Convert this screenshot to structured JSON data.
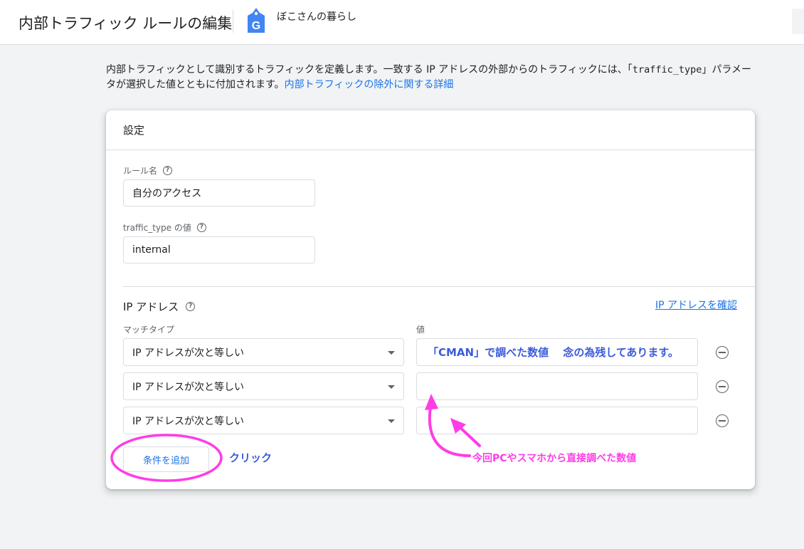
{
  "header": {
    "title": "内部トラフィック ルールの編集",
    "property_name": "ぼこさんの暮らし",
    "tag_letter": "G"
  },
  "description": {
    "text_part1": "内部トラフィックとして識別するトラフィックを定義します。一致する IP アドレスの外部からのトラフィックには、「",
    "code": "traffic_type",
    "text_part2": "」パラメータが選択した値とともに付加されます。",
    "link_text": "内部トラフィックの除外に関する詳細"
  },
  "settings": {
    "title": "設定",
    "rule_name_label": "ルール名",
    "rule_name_value": "自分のアクセス",
    "traffic_type_label": "traffic_type の値",
    "traffic_type_value": "internal"
  },
  "ip_section": {
    "title": "IP アドレス",
    "verify_link": "IP アドレスを確認",
    "match_type_label": "マッチタイプ",
    "value_label": "値",
    "conditions": [
      {
        "match_type": "IP アドレスが次と等しい",
        "value": ""
      },
      {
        "match_type": "IP アドレスが次と等しい",
        "value": ""
      },
      {
        "match_type": "IP アドレスが次と等しい",
        "value": ""
      }
    ],
    "add_condition_label": "条件を追加"
  },
  "annotations": {
    "click_label": "クリック",
    "cman_note": "「CMAN」で調べた数値　 念の為残してあります。",
    "device_note": "今回PCやスマホから直接調べた数値",
    "colors": {
      "pink": "#ff3ce6",
      "blue": "#3b5bdb"
    }
  },
  "icons": {
    "help": "help-circle-icon",
    "remove": "remove-circle-icon",
    "dropdown": "dropdown-arrow-icon",
    "tag": "analytics-tag-icon"
  },
  "colors": {
    "link": "#1a73e8",
    "text": "#202124",
    "secondary": "#5f6368",
    "background": "#f1f3f4"
  }
}
